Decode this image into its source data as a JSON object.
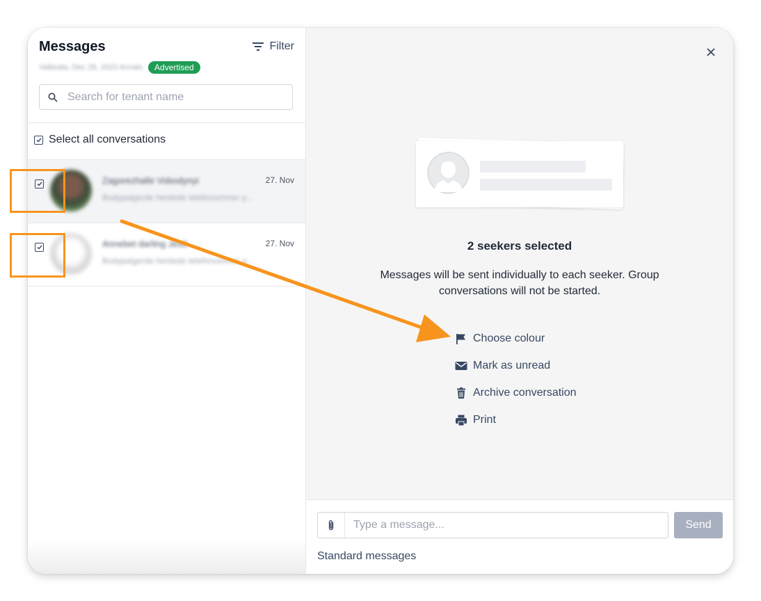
{
  "left": {
    "title": "Messages",
    "filter_label": "Filter",
    "subline_blurred": "Valkeala, Dec 28, 2023 Annals",
    "badge": "Advertised",
    "search_placeholder": "Search for tenant name",
    "select_all_label": "Select all conversations",
    "conversations": [
      {
        "name": "Zagorezhalle Vobodynyi",
        "preview": "Bodypalgerde hentede telefonummer y...",
        "date": "27. Nov"
      },
      {
        "name": "Annebet darling Jestt",
        "preview": "Bodypalgerde hentede telefonummer a...",
        "date": "27. Nov"
      }
    ]
  },
  "right": {
    "close_icon": "close-icon",
    "heading": "2 seekers selected",
    "description": "Messages will be sent individually to each seeker. Group conversations will not be started.",
    "actions": [
      {
        "label": "Choose colour",
        "icon": "flag-icon"
      },
      {
        "label": "Mark as unread",
        "icon": "envelope-icon"
      },
      {
        "label": "Archive conversation",
        "icon": "trash-icon"
      },
      {
        "label": "Print",
        "icon": "printer-icon"
      }
    ]
  },
  "composer": {
    "placeholder": "Type a message...",
    "send_label": "Send",
    "standard_messages_label": "Standard messages"
  },
  "colors": {
    "accent": "#374863",
    "badge": "#1f9d55",
    "highlight": "#f7941d",
    "send_disabled": "#a8b0c0"
  }
}
